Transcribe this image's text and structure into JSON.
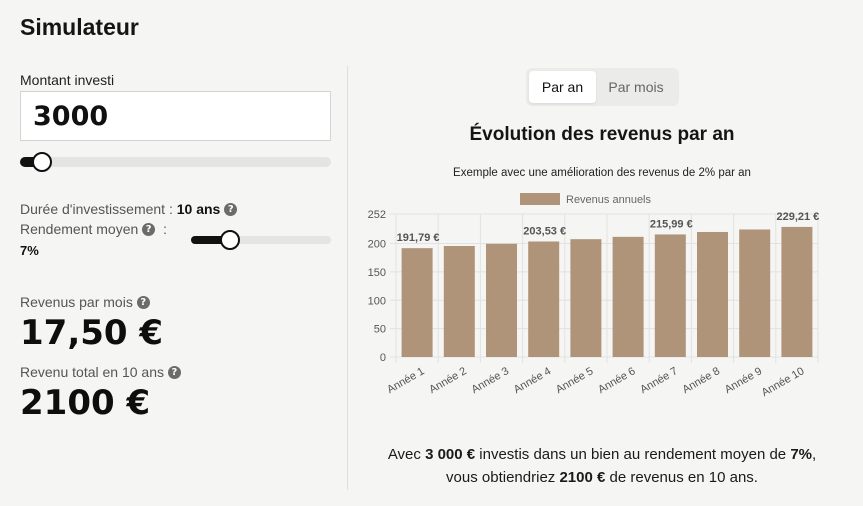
{
  "title": "Simulateur",
  "amount": {
    "label": "Montant investi",
    "value": "3000",
    "slider_fraction": 0.07
  },
  "duration": {
    "label": "Durée d'investissement :",
    "value": "10 ans"
  },
  "yield": {
    "label": "Rendement moyen",
    "value": "7%",
    "slider_fraction": 0.28
  },
  "revenue_month": {
    "label": "Revenus par mois",
    "value": "17,50 €"
  },
  "revenue_total": {
    "label": "Revenu total en 10 ans",
    "value": "2100 €"
  },
  "toggle": {
    "options": [
      "Par an",
      "Par mois"
    ],
    "active": "Par an"
  },
  "colors": {
    "bar": "#b09479",
    "accent": "#111111"
  },
  "chart_data": {
    "type": "bar",
    "title": "Évolution des revenus par an",
    "subtitle": "Exemple avec une amélioration des revenus de 2% par an",
    "legend": [
      "Revenus annuels"
    ],
    "legend_position": "top",
    "categories": [
      "Année 1",
      "Année 2",
      "Année 3",
      "Année 4",
      "Année 5",
      "Année 6",
      "Année 7",
      "Année 8",
      "Année 9",
      "Année 10"
    ],
    "series": [
      {
        "name": "Revenus annuels",
        "values": [
          191.79,
          195.63,
          199.54,
          203.53,
          207.6,
          211.75,
          215.99,
          220.31,
          224.71,
          229.21
        ]
      }
    ],
    "data_labels": [
      "191,79 €",
      "",
      "",
      "203,53 €",
      "",
      "",
      "215,99 €",
      "",
      "",
      "229,21 €"
    ],
    "yticks": [
      0,
      50,
      100,
      150,
      200,
      252
    ],
    "ylim": [
      0,
      252
    ],
    "grid": true
  },
  "summary": {
    "p1": "Avec ",
    "amount": "3 000 €",
    "p2": " investis dans un bien au rendement moyen de ",
    "rate": "7%",
    "p3": ",",
    "p4": "vous obtiendriez ",
    "total": "2100 €",
    "p5": " de revenus en 10 ans."
  }
}
